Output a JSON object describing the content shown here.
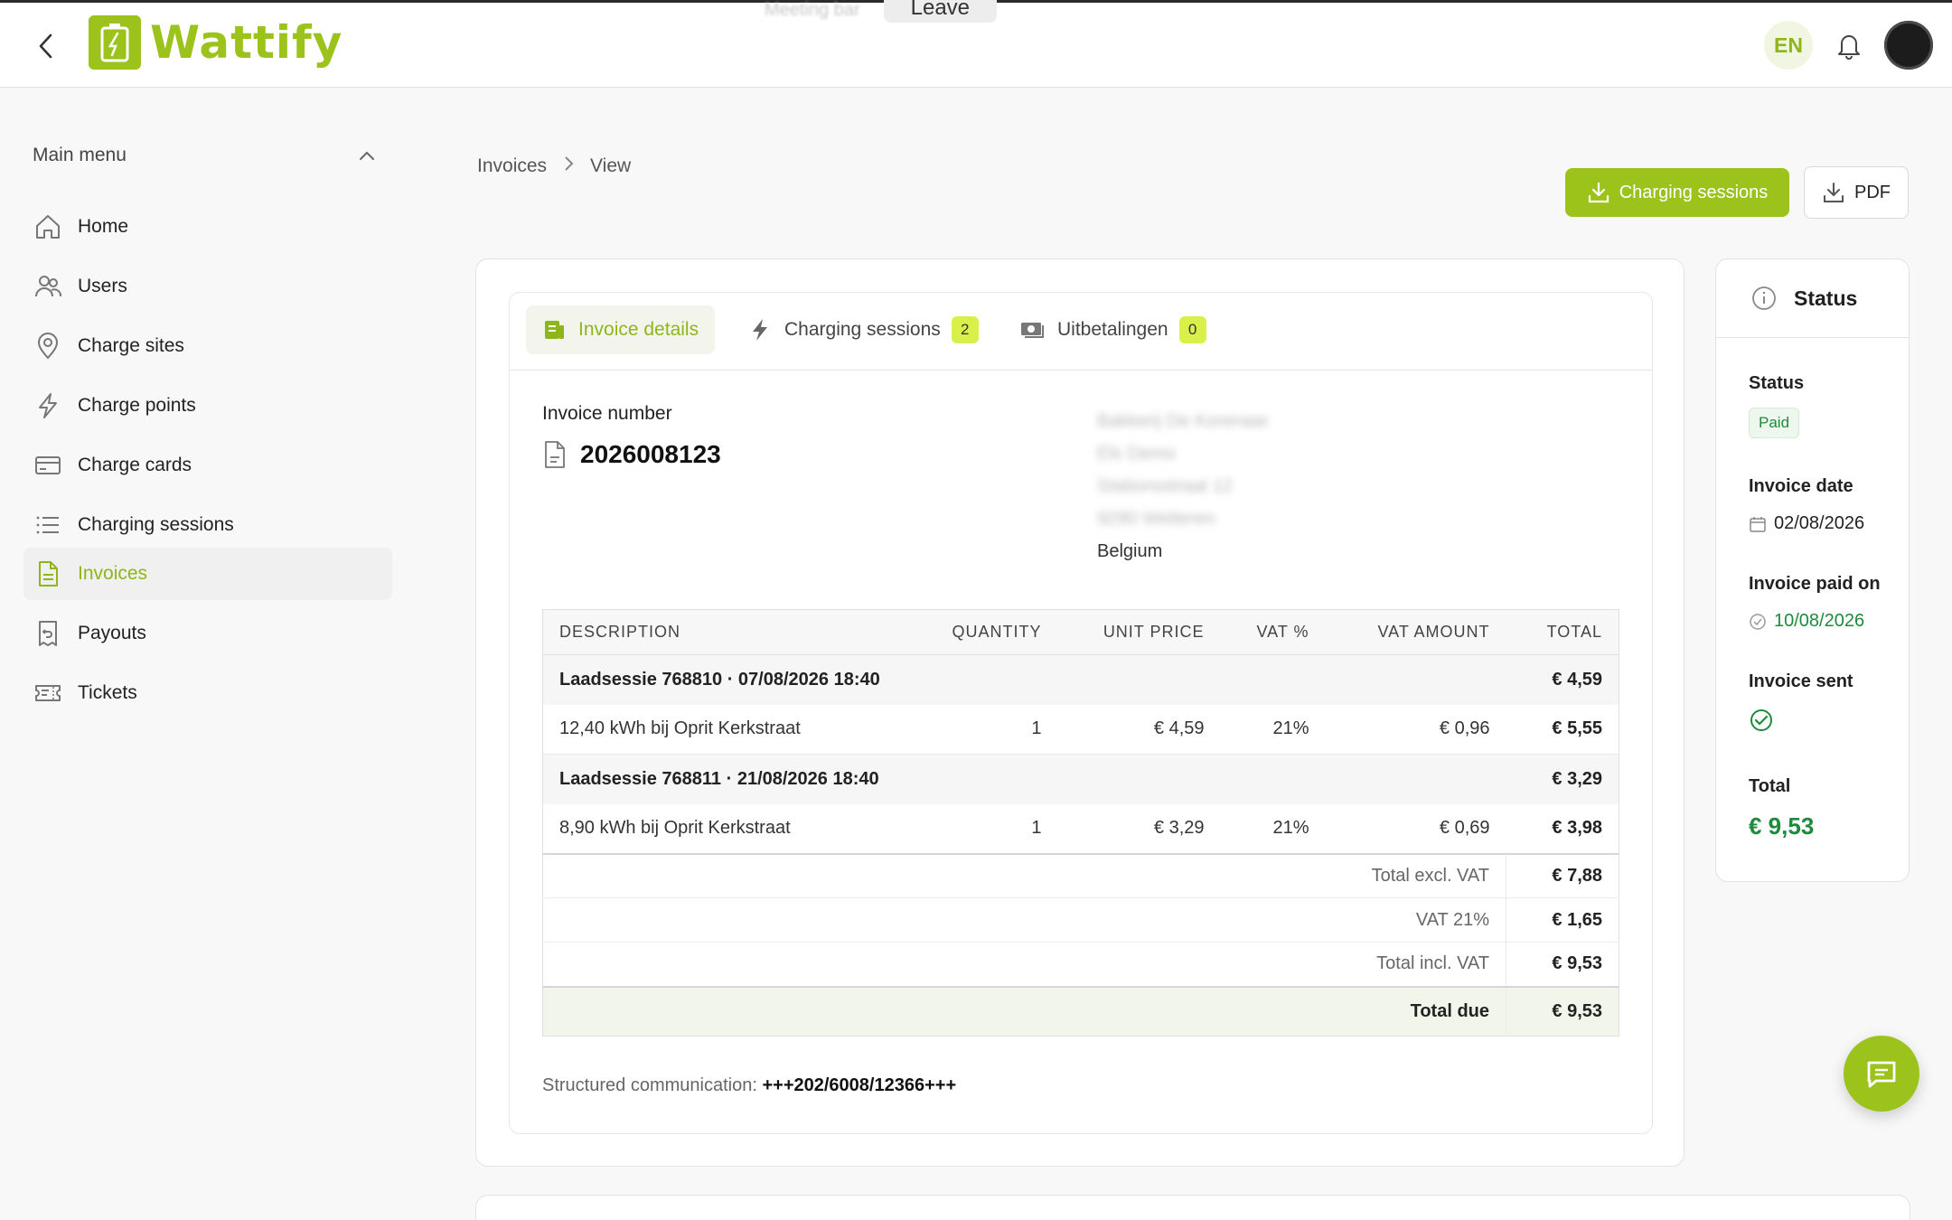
{
  "header": {
    "brand": "Wattify",
    "meeting_text": "Meeting bar",
    "leave_label": "Leave",
    "lang": "EN"
  },
  "sidebar": {
    "title": "Main menu",
    "items": [
      {
        "label": "Home",
        "icon": "home-icon"
      },
      {
        "label": "Users",
        "icon": "users-icon"
      },
      {
        "label": "Charge sites",
        "icon": "location-pin-icon"
      },
      {
        "label": "Charge points",
        "icon": "bolt-icon"
      },
      {
        "label": "Charge cards",
        "icon": "card-icon"
      },
      {
        "label": "Charging sessions",
        "icon": "list-icon"
      },
      {
        "label": "Invoices",
        "icon": "document-icon",
        "active": true
      },
      {
        "label": "Payouts",
        "icon": "receipt-icon"
      },
      {
        "label": "Tickets",
        "icon": "ticket-icon"
      }
    ]
  },
  "breadcrumb": [
    "Invoices",
    "View"
  ],
  "actions": {
    "charging_sessions_label": "Charging sessions",
    "pdf_label": "PDF"
  },
  "tabs": [
    {
      "label": "Invoice details",
      "active": true
    },
    {
      "label": "Charging sessions",
      "count": "2"
    },
    {
      "label": "Uitbetalingen",
      "count": "0"
    }
  ],
  "invoice": {
    "number_label": "Invoice number",
    "number": "2026008123",
    "address": {
      "blurred": [
        "Bakkerij De Korenaar",
        "Els Demo",
        "Stationsstraat 12",
        "9290 Wetteren"
      ],
      "country": "Belgium"
    },
    "table": {
      "headers": [
        "DESCRIPTION",
        "QUANTITY",
        "UNIT PRICE",
        "VAT %",
        "VAT AMOUNT",
        "TOTAL"
      ],
      "groups": [
        {
          "title": "Laadsessie 768810 · 07/08/2026 18:40",
          "total": "€ 4,59",
          "line": {
            "description": "12,40 kWh bij Oprit Kerkstraat",
            "quantity": "1",
            "unit_price": "€ 4,59",
            "vat_pct": "21%",
            "vat_amount": "€ 0,96",
            "total": "€ 5,55"
          }
        },
        {
          "title": "Laadsessie 768811 · 21/08/2026 18:40",
          "total": "€ 3,29",
          "line": {
            "description": "8,90 kWh bij Oprit Kerkstraat",
            "quantity": "1",
            "unit_price": "€ 3,29",
            "vat_pct": "21%",
            "vat_amount": "€ 0,69",
            "total": "€ 3,98"
          }
        }
      ],
      "summary": [
        {
          "label": "Total excl. VAT",
          "value": "€ 7,88"
        },
        {
          "label": "VAT 21%",
          "value": "€ 1,65"
        },
        {
          "label": "Total incl. VAT",
          "value": "€ 9,53"
        }
      ],
      "due": {
        "label": "Total due",
        "value": "€ 9,53"
      }
    },
    "structured_label": "Structured communication:",
    "structured_value": "+++202/6008/12366+++"
  },
  "status": {
    "title": "Status",
    "status_label": "Status",
    "status_value": "Paid",
    "date_label": "Invoice date",
    "date_value": "02/08/2026",
    "paid_on_label": "Invoice paid on",
    "paid_on_value": "10/08/2026",
    "sent_label": "Invoice sent",
    "total_label": "Total",
    "total_value": "€ 9,53"
  },
  "colors": {
    "accent": "#9cc21c",
    "success": "#1e8a3c",
    "badge": "#d9f04a"
  }
}
